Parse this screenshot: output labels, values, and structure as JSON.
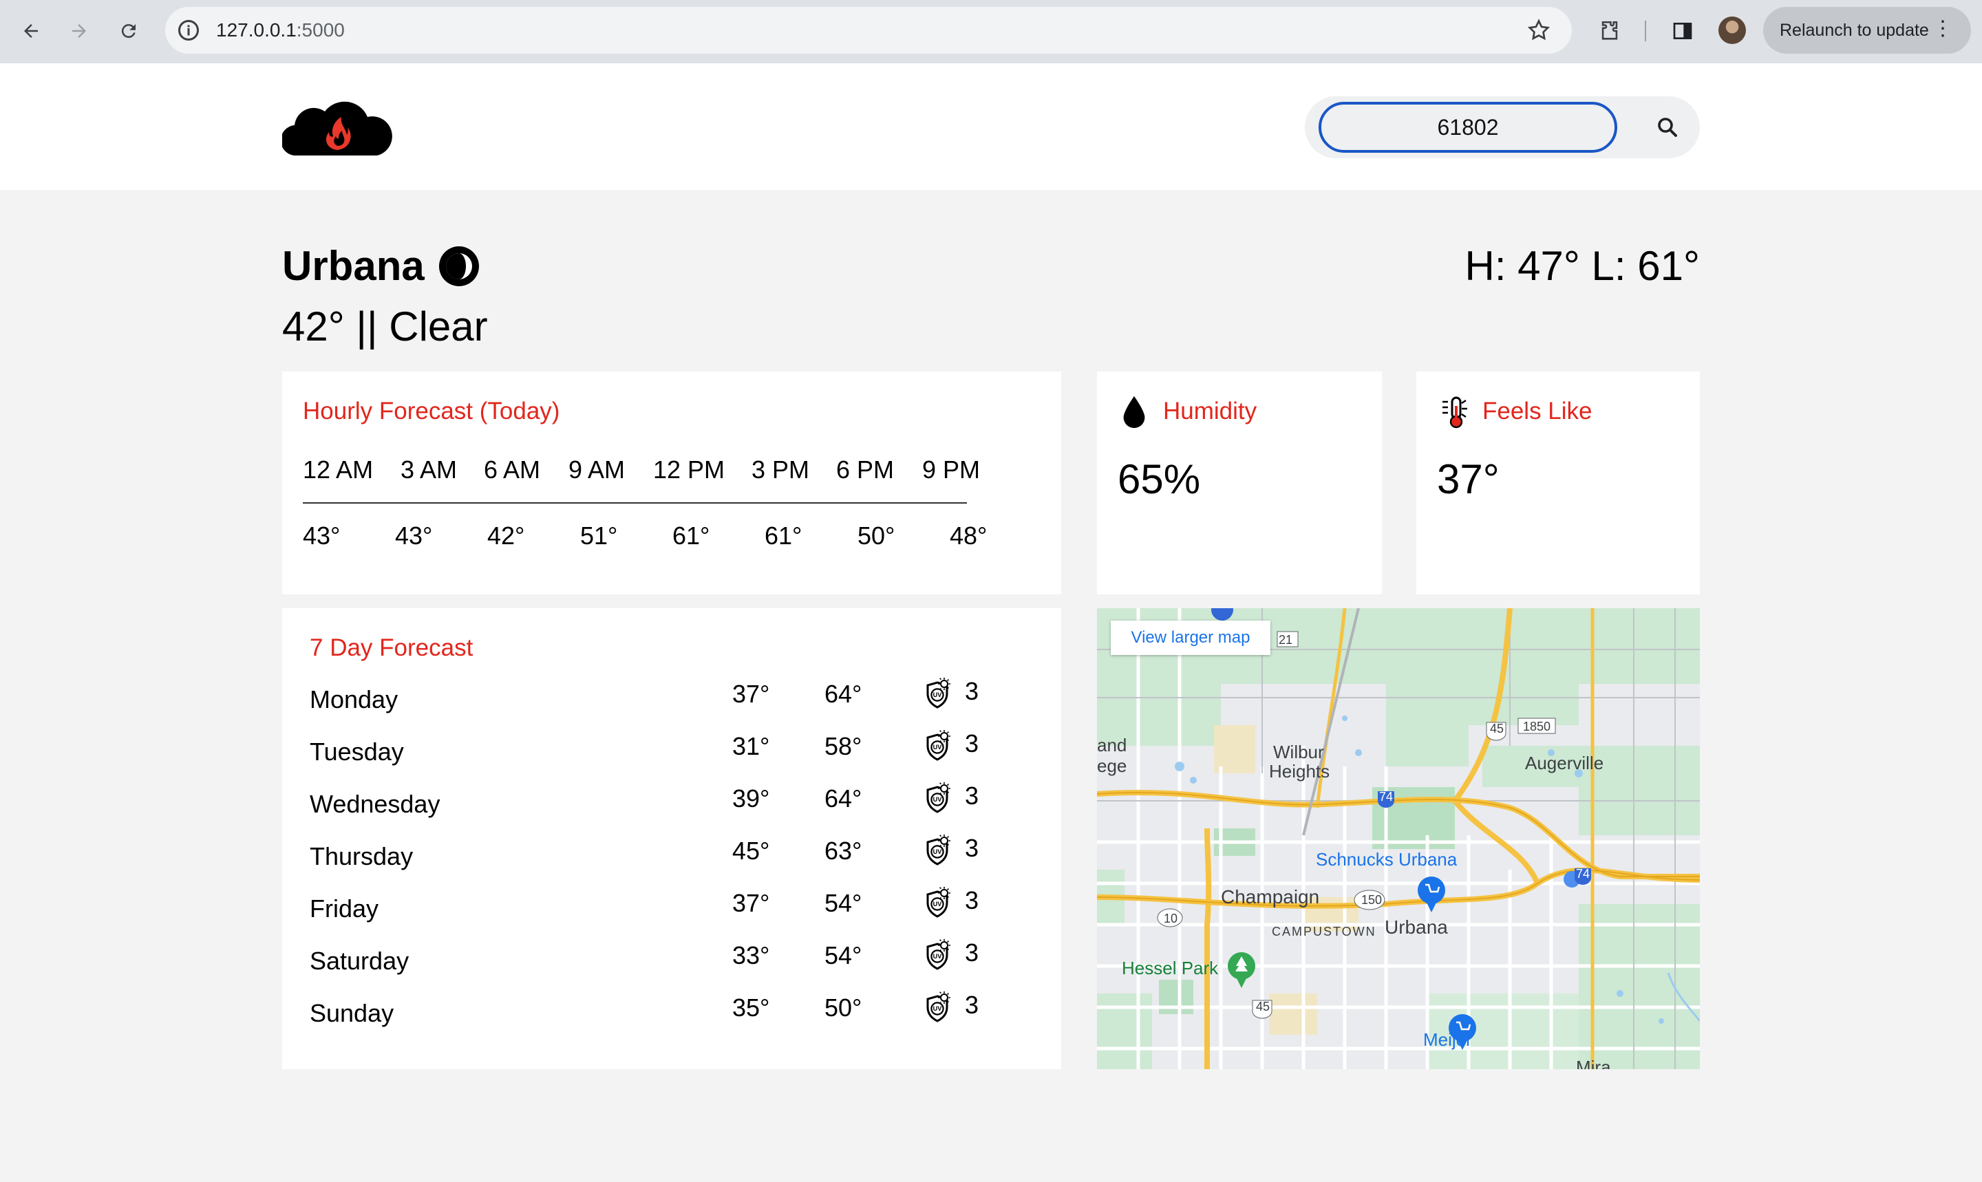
{
  "browser": {
    "url_host": "127.0.0.1",
    "url_port": ":5000",
    "relaunch_label": "Relaunch to update"
  },
  "header": {
    "search_value": "61802"
  },
  "current": {
    "city": "Urbana",
    "conditions": "42° || Clear",
    "hilo": "H: 47° L: 61°"
  },
  "hourly": {
    "title": "Hourly Forecast (Today)",
    "times": [
      "12 AM",
      "3 AM",
      "6 AM",
      "9 AM",
      "12 PM",
      "3 PM",
      "6 PM",
      "9 PM"
    ],
    "temps": [
      "43°",
      "43°",
      "42°",
      "51°",
      "61°",
      "61°",
      "50°",
      "48°"
    ]
  },
  "humidity": {
    "title": "Humidity",
    "value": "65%"
  },
  "feels_like": {
    "title": "Feels Like",
    "value": "37°"
  },
  "daily": {
    "title": "7 Day Forecast",
    "days": [
      {
        "name": "Monday",
        "lo": "37°",
        "hi": "64°",
        "uv": "3"
      },
      {
        "name": "Tuesday",
        "lo": "31°",
        "hi": "58°",
        "uv": "3"
      },
      {
        "name": "Wednesday",
        "lo": "39°",
        "hi": "64°",
        "uv": "3"
      },
      {
        "name": "Thursday",
        "lo": "45°",
        "hi": "63°",
        "uv": "3"
      },
      {
        "name": "Friday",
        "lo": "37°",
        "hi": "54°",
        "uv": "3"
      },
      {
        "name": "Saturday",
        "lo": "33°",
        "hi": "54°",
        "uv": "3"
      },
      {
        "name": "Sunday",
        "lo": "35°",
        "hi": "50°",
        "uv": "3"
      }
    ]
  },
  "map": {
    "button_label": "View larger map",
    "labels": {
      "wilbur": "Wilbur",
      "heights": "Heights",
      "augerville": "Augerville",
      "champaign": "Champaign",
      "urbana": "Urbana",
      "campustown": "CAMPUSTOWN",
      "schnucks": "Schnucks Urbana",
      "hessel": "Hessel Park",
      "meijer": "Meijer",
      "and": "and",
      "ege": "ege",
      "mira": "Mira",
      "r21": "21",
      "r45a": "45",
      "r45b": "45",
      "r1850": "1850",
      "r74a": "74",
      "r74b": "74",
      "r150": "150",
      "r10": "10"
    }
  },
  "colors": {
    "accent_red": "#e2261c",
    "search_border": "#1a56c6",
    "map_link": "#1a73e8"
  }
}
